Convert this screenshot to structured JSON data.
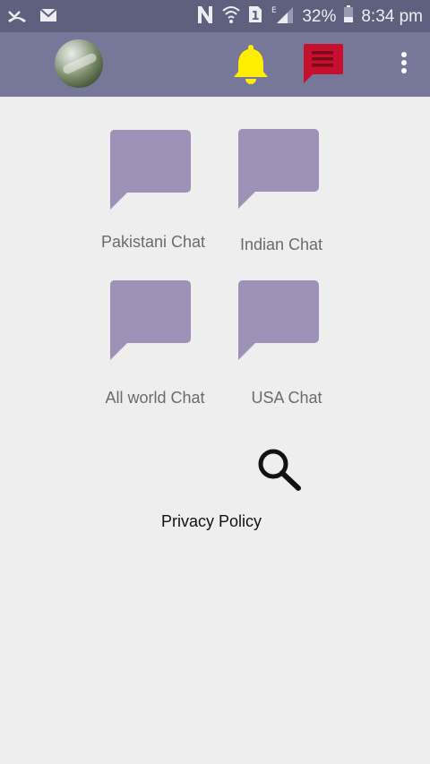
{
  "status_bar": {
    "battery": "32%",
    "time": "8:34 pm",
    "network_label": "E",
    "sim_label": "1"
  },
  "app_bar": {
    "avatar_icon": "profile-avatar",
    "bell_color": "#ffee00",
    "message_color": "#c8102e",
    "background": "#77779a"
  },
  "rooms": [
    {
      "label": "Pakistani Chat"
    },
    {
      "label": "Indian Chat"
    },
    {
      "label": "All world Chat"
    },
    {
      "label": "USA Chat"
    }
  ],
  "bubble_color": "#9d91b7",
  "search": {
    "icon": "search-icon"
  },
  "footer": {
    "privacy_label": "Privacy Policy"
  }
}
